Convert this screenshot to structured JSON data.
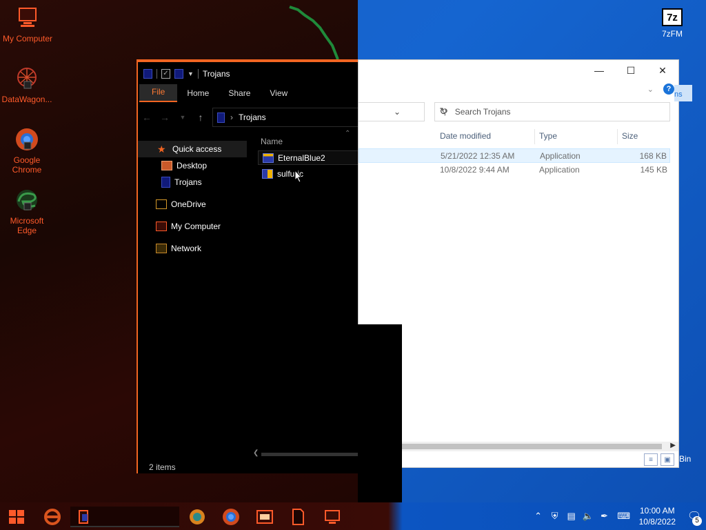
{
  "desktop": {
    "icons": [
      {
        "label": "My Computer",
        "icon": "computer-icon"
      },
      {
        "label": "DataWagon...",
        "icon": "datawagon-icon"
      },
      {
        "label": "Google Chrome",
        "icon": "chrome-icon"
      },
      {
        "label": "Microsoft Edge",
        "icon": "edge-icon"
      },
      {
        "label": "7zFM",
        "icon": "7zip-icon"
      },
      {
        "label": "Bin",
        "icon": "recycle-bin-icon"
      }
    ],
    "seven_zip_glyph": "7z"
  },
  "light_window": {
    "search_placeholder": "Search Trojans",
    "help_tail": "ns",
    "columns": [
      "Date modified",
      "Type",
      "Size"
    ],
    "rows": [
      {
        "date": "5/21/2022 12:35 AM",
        "type": "Application",
        "size": "168 KB"
      },
      {
        "date": "10/8/2022 9:44 AM",
        "type": "Application",
        "size": "145 KB"
      }
    ]
  },
  "dark_window": {
    "title": "Trojans",
    "ribbon_tabs": [
      "File",
      "Home",
      "Share",
      "View"
    ],
    "address": "Trojans",
    "nav": [
      "Quick access",
      "Desktop",
      "Trojans",
      "OneDrive",
      "My Computer",
      "Network"
    ],
    "column_name": "Name",
    "files": [
      "EternalBlue2",
      "sulfuric"
    ],
    "status": "2 items"
  },
  "taskbar": {
    "time": "10:00 AM",
    "date": "10/8/2022",
    "notification_count": "5"
  }
}
